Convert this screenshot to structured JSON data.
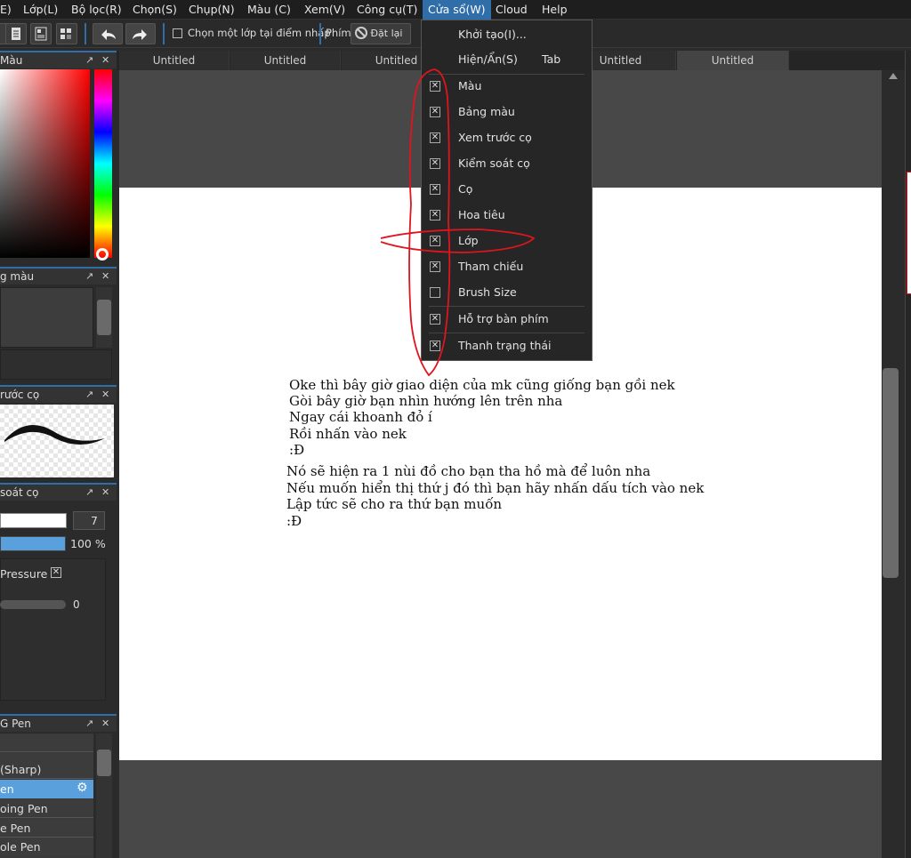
{
  "menubar": {
    "items": [
      "E)",
      "Lớp(L)",
      "Bộ lọc(R)",
      "Chọn(S)",
      "Chụp(N)",
      "Màu (C)",
      "Xem(V)",
      "Công cụ(T)",
      "Cửa sổ(W)",
      "Cloud",
      "Help"
    ],
    "active_index": 8
  },
  "toolbar": {
    "select_layer_label": "Chọn một lớp tại điểm nhấp",
    "key_label": "Phím",
    "reset_label": "Đặt lại"
  },
  "panels": {
    "color_title": "Màu",
    "palette_title": "g màu",
    "brush_preview_title": "rước cọ",
    "brush_control_title": "soát cọ",
    "brush_size_value": "7",
    "opacity_value": "100 %",
    "pressure_label": "Pressure",
    "slider_value": "0",
    "brush_list_title": "G Pen",
    "brush_items": [
      "(Sharp)",
      "en",
      "oing Pen",
      "e Pen",
      "ole Pen"
    ],
    "selected_brush_index": 1
  },
  "tabs": [
    "Untitled",
    "Untitled",
    "Untitled",
    "",
    "Untitled",
    "Untitled"
  ],
  "active_tab_index": 5,
  "canvas_text": {
    "paragraph1": [
      "Oke thì bây giờ giao diện của mk cũng giống bạn gồi nek",
      "Gòi bây giờ bạn nhìn hướng lên trên nha",
      "Ngay cái khoanh đỏ í",
      "Rồi nhấn vào nek",
      ":Đ"
    ],
    "paragraph2": [
      "Nó sẽ hiện ra 1 nùi đồ cho bạn tha hồ mà để luôn nha",
      "Nếu muốn hiển thị thứ j đó thì bạn hãy nhấn dấu tích vào nek",
      "Lập tức sẽ cho ra thứ bạn muốn",
      ":Đ"
    ]
  },
  "window_menu": {
    "new_label": "Khởi tạo(I)...",
    "toggle_label": "Hiện/Ẩn(S)",
    "toggle_shortcut": "Tab",
    "items": [
      {
        "label": "Màu",
        "checked": true
      },
      {
        "label": "Bảng màu",
        "checked": true
      },
      {
        "label": "Xem trước cọ",
        "checked": true
      },
      {
        "label": "Kiểm soát cọ",
        "checked": true
      },
      {
        "label": "Cọ",
        "checked": true
      },
      {
        "label": "Hoa tiêu",
        "checked": true
      },
      {
        "label": "Lớp",
        "checked": true
      },
      {
        "label": "Tham chiếu",
        "checked": true
      },
      {
        "label": "Brush Size",
        "checked": false
      }
    ],
    "extra_items": [
      {
        "label": "Hỗ trợ bàn phím",
        "checked": true
      },
      {
        "label": "Thanh trạng thái",
        "checked": true
      }
    ]
  },
  "colors": {
    "accent": "#2f6ea8",
    "annotation": "#e0141e",
    "selected": "#5aa0dc"
  }
}
